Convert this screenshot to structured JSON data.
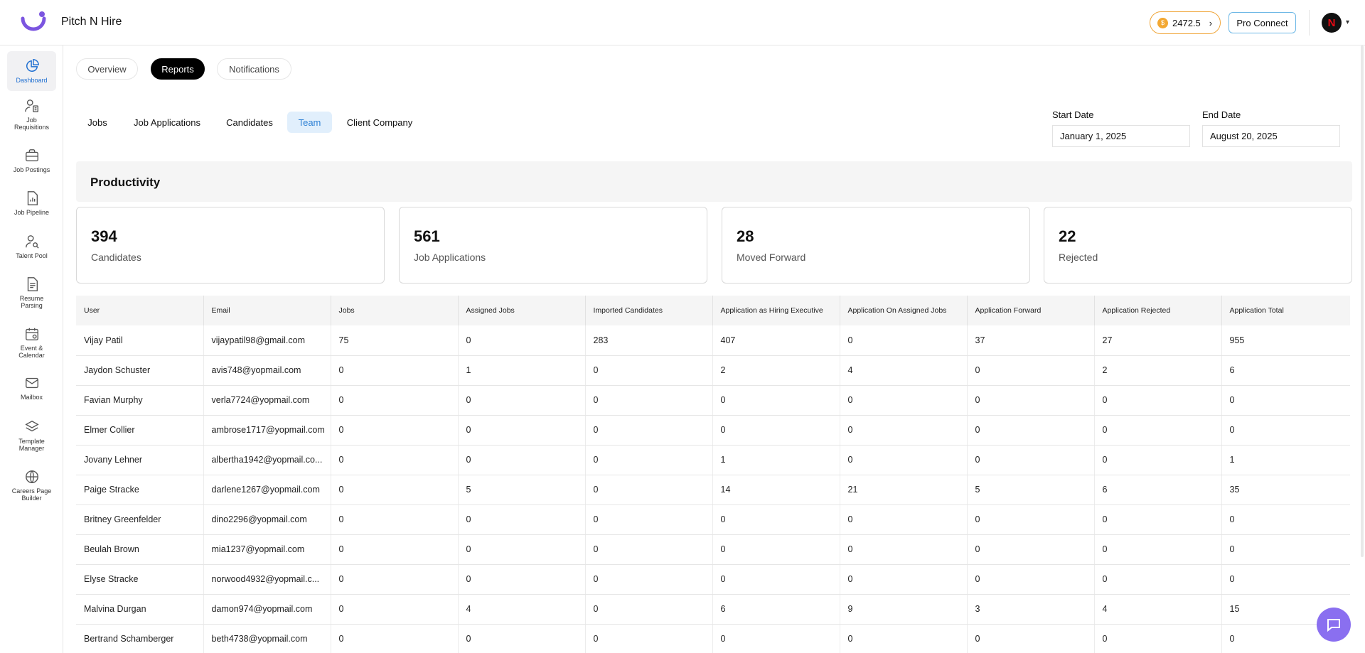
{
  "header": {
    "brand": "Pitch N Hire",
    "credits": "2472.5",
    "pro_connect": "Pro Connect",
    "avatar_letter": "N"
  },
  "sidebar": {
    "items": [
      {
        "label": "Dashboard"
      },
      {
        "label": "Job Requisitions"
      },
      {
        "label": "Job Postings"
      },
      {
        "label": "Job Pipeline"
      },
      {
        "label": "Talent Pool"
      },
      {
        "label": "Resume Parsing"
      },
      {
        "label": "Event & Calendar"
      },
      {
        "label": "Mailbox"
      },
      {
        "label": "Template Manager"
      },
      {
        "label": "Careers Page Builder"
      }
    ]
  },
  "main_tabs": [
    "Overview",
    "Reports",
    "Notifications"
  ],
  "report_tabs": [
    "Jobs",
    "Job Applications",
    "Candidates",
    "Team",
    "Client Company"
  ],
  "dates": {
    "start_label": "Start Date",
    "start_value": "January 1, 2025",
    "end_label": "End Date",
    "end_value": "August 20, 2025"
  },
  "productivity": {
    "title": "Productivity",
    "cards": [
      {
        "value": "394",
        "label": "Candidates"
      },
      {
        "value": "561",
        "label": "Job Applications"
      },
      {
        "value": "28",
        "label": "Moved Forward"
      },
      {
        "value": "22",
        "label": "Rejected"
      }
    ]
  },
  "table": {
    "headers": [
      "User",
      "Email",
      "Jobs",
      "Assigned Jobs",
      "Imported Candidates",
      "Application as Hiring Executive",
      "Application On Assigned Jobs",
      "Application Forward",
      "Application Rejected",
      "Application Total"
    ],
    "rows": [
      [
        "Vijay Patil",
        "vijaypatil98@gmail.com",
        "75",
        "0",
        "283",
        "407",
        "0",
        "37",
        "27",
        "955"
      ],
      [
        "Jaydon Schuster",
        "avis748@yopmail.com",
        "0",
        "1",
        "0",
        "2",
        "4",
        "0",
        "2",
        "6"
      ],
      [
        "Favian Murphy",
        "verla7724@yopmail.com",
        "0",
        "0",
        "0",
        "0",
        "0",
        "0",
        "0",
        "0"
      ],
      [
        "Elmer Collier",
        "ambrose1717@yopmail.com",
        "0",
        "0",
        "0",
        "0",
        "0",
        "0",
        "0",
        "0"
      ],
      [
        "Jovany Lehner",
        "albertha1942@yopmail.co...",
        "0",
        "0",
        "0",
        "1",
        "0",
        "0",
        "0",
        "1"
      ],
      [
        "Paige Stracke",
        "darlene1267@yopmail.com",
        "0",
        "5",
        "0",
        "14",
        "21",
        "5",
        "6",
        "35"
      ],
      [
        "Britney Greenfelder",
        "dino2296@yopmail.com",
        "0",
        "0",
        "0",
        "0",
        "0",
        "0",
        "0",
        "0"
      ],
      [
        "Beulah Brown",
        "mia1237@yopmail.com",
        "0",
        "0",
        "0",
        "0",
        "0",
        "0",
        "0",
        "0"
      ],
      [
        "Elyse Stracke",
        "norwood4932@yopmail.c...",
        "0",
        "0",
        "0",
        "0",
        "0",
        "0",
        "0",
        "0"
      ],
      [
        "Malvina Durgan",
        "damon974@yopmail.com",
        "0",
        "4",
        "0",
        "6",
        "9",
        "3",
        "4",
        "15"
      ],
      [
        "Bertrand Schamberger",
        "beth4738@yopmail.com",
        "0",
        "0",
        "0",
        "0",
        "0",
        "0",
        "0",
        "0"
      ]
    ]
  },
  "colors": {
    "accent_blue": "#2a7fd4",
    "credits_border": "#f0a63a",
    "pro_border": "#6db8e6",
    "chat_fab": "#8a6ff0",
    "logo_purple": "#7b55e0"
  }
}
